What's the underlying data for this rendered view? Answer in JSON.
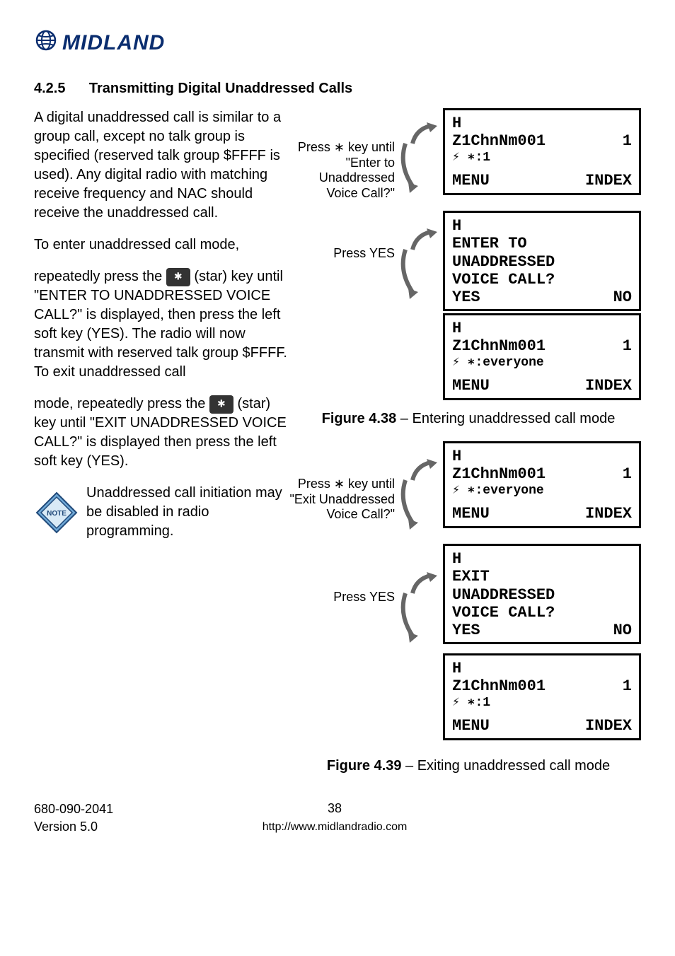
{
  "logo": {
    "brand_text": "MIDLAND"
  },
  "section": {
    "number": "4.2.5",
    "title": "Transmitting Digital Unaddressed Calls"
  },
  "body": {
    "para1": "A digital unaddressed call is similar to a group call, except no talk group is specified (reserved talk group $FFFF is used). Any digital radio with matching receive frequency and NAC should receive the unaddressed call.",
    "para2a": "To enter unaddressed call mode,",
    "para2b_pre": "repeatedly press the ",
    "para2b_post": " (star) key until \"ENTER TO UNADDRESSED VOICE CALL?\" is displayed, then press the left soft key (YES). The radio will now transmit with reserved talk group $FFFF. To exit unaddressed call",
    "para3_pre": "mode, repeatedly press the ",
    "para3_post": " (star) key until \"EXIT UNADDRESSED VOICE CALL?\" is displayed then press the left soft key (YES).",
    "note": "Unaddressed call initiation may be disabled in radio programming.",
    "note_badge": "NOTE"
  },
  "diagram1": {
    "label1": "Press ∗ key until \"Enter to Unaddressed Voice Call?\"",
    "label2": "Press YES",
    "lcd1": {
      "hdr": "H",
      "line1_left": "Z1ChnNm001",
      "line1_right": "1",
      "line2": "⚡  ∗:1",
      "soft_left": "MENU",
      "soft_right": "INDEX"
    },
    "lcd2": {
      "hdr": "H",
      "line1": "ENTER TO",
      "line2": "UNADDRESSED",
      "line3": "VOICE CALL?",
      "soft_left": "YES",
      "soft_right": "NO"
    },
    "lcd3": {
      "hdr": "H",
      "line1_left": "Z1ChnNm001",
      "line1_right": "1",
      "line2": "⚡  ∗:everyone",
      "soft_left": "MENU",
      "soft_right": "INDEX"
    },
    "caption_bold": "Figure 4.38",
    "caption_rest": " – Entering unaddressed call mode"
  },
  "diagram2": {
    "label1": "Press ∗ key until \"Exit Unaddressed Voice Call?\"",
    "label2": "Press YES",
    "lcd1": {
      "hdr": "H",
      "line1_left": "Z1ChnNm001",
      "line1_right": "1",
      "line2": "⚡  ∗:everyone",
      "soft_left": "MENU",
      "soft_right": "INDEX"
    },
    "lcd2": {
      "hdr": "H",
      "line1": "EXIT",
      "line2": "UNADDRESSED",
      "line3": "VOICE CALL?",
      "soft_left": "YES",
      "soft_right": "NO"
    },
    "lcd3": {
      "hdr": "H",
      "line1_left": "Z1ChnNm001",
      "line1_right": "1",
      "line2": "⚡  ∗:1",
      "soft_left": "MENU",
      "soft_right": "INDEX"
    },
    "caption_bold": "Figure 4.39",
    "caption_rest": " – Exiting unaddressed call mode"
  },
  "footer": {
    "doc_num": "680-090-2041",
    "version": "Version 5.0",
    "page": "38",
    "url": "http://www.midlandradio.com"
  }
}
